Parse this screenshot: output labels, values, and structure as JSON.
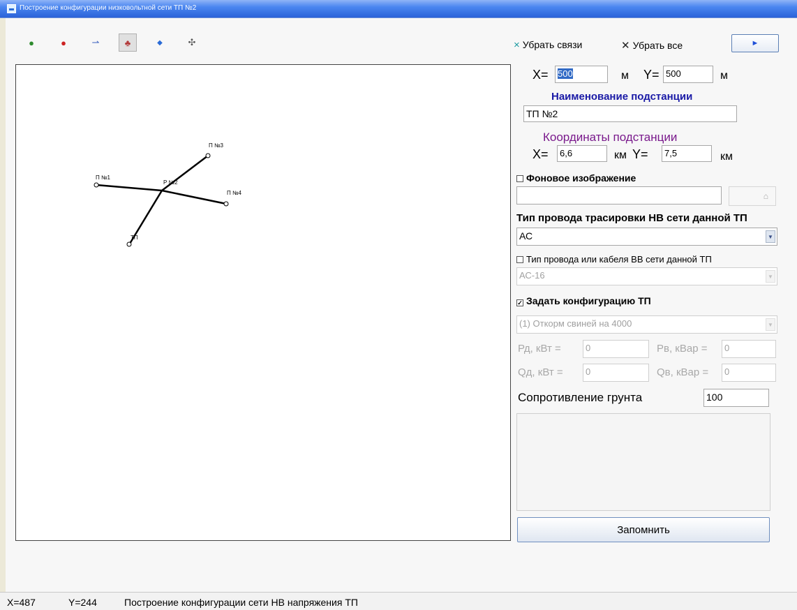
{
  "window": {
    "title": "Построение конфигурации низковольтной сети ТП №2"
  },
  "toolbar": {
    "icons": [
      {
        "name": "green-node-icon",
        "glyph": "●",
        "color": "#2e8b2e"
      },
      {
        "name": "red-node-icon",
        "glyph": "●",
        "color": "#cc2222"
      },
      {
        "name": "connect-lines-icon",
        "glyph": "⇀",
        "color": "#3a5fbf"
      },
      {
        "name": "network-tree-icon",
        "glyph": "♣",
        "color": "#b33a3a"
      },
      {
        "name": "blue-diamond-icon",
        "glyph": "◆",
        "color": "#2a6bd6"
      },
      {
        "name": "move-icon",
        "glyph": "✣",
        "color": "#555555"
      }
    ],
    "remove_links_label": "Убрать связи",
    "remove_all_label": "Убрать все",
    "play_label": "►"
  },
  "diagram": {
    "nodes": [
      {
        "label": "П №1"
      },
      {
        "label": "Р №2"
      },
      {
        "label": "П №3"
      },
      {
        "label": "П №4"
      },
      {
        "label": "ТП"
      }
    ]
  },
  "panel": {
    "x_label": "X=",
    "x_value": "500",
    "y_label": "Y=",
    "y_value": "500",
    "unit_m": "м",
    "substation_name_label": "Наименование подстанции",
    "substation_name_value": "ТП №2",
    "coords_label": "Координаты подстанции",
    "coord_x_label": "X=",
    "coord_x_value": "6,6",
    "coord_y_label": "Y=",
    "coord_y_value": "7,5",
    "unit_km": "км",
    "background_label": "Фоновое изображение",
    "background_path": "",
    "wire_type_label": "Тип провода трасировки НВ сети данной ТП",
    "wire_type_value": "АС",
    "hv_wire_label": "Тип провода или кабеля ВВ сети данной ТП",
    "hv_wire_value": "АС-16",
    "config_label": "Задать конфигурацию ТП",
    "config_value": "(1) Откорм свиней на 4000",
    "pd_label": "Рд, кВт =",
    "pd_value": "0",
    "pv_label": "Рв, кВар =",
    "pv_value": "0",
    "qd_label": "Qд, кВт =",
    "qd_value": "0",
    "qv_label": "Qв, кВар =",
    "qv_value": "0",
    "soil_label": "Сопротивление грунта",
    "soil_value": "100",
    "save_label": "Запомнить"
  },
  "status": {
    "x": "X=487",
    "y": "Y=244",
    "text": "Построение конфигурации сети НВ напряжения ТП"
  },
  "colors": {
    "title_blue": "#1a1aa6",
    "coords_purple": "#7a1a8c",
    "link_teal": "#1a9aa0"
  }
}
